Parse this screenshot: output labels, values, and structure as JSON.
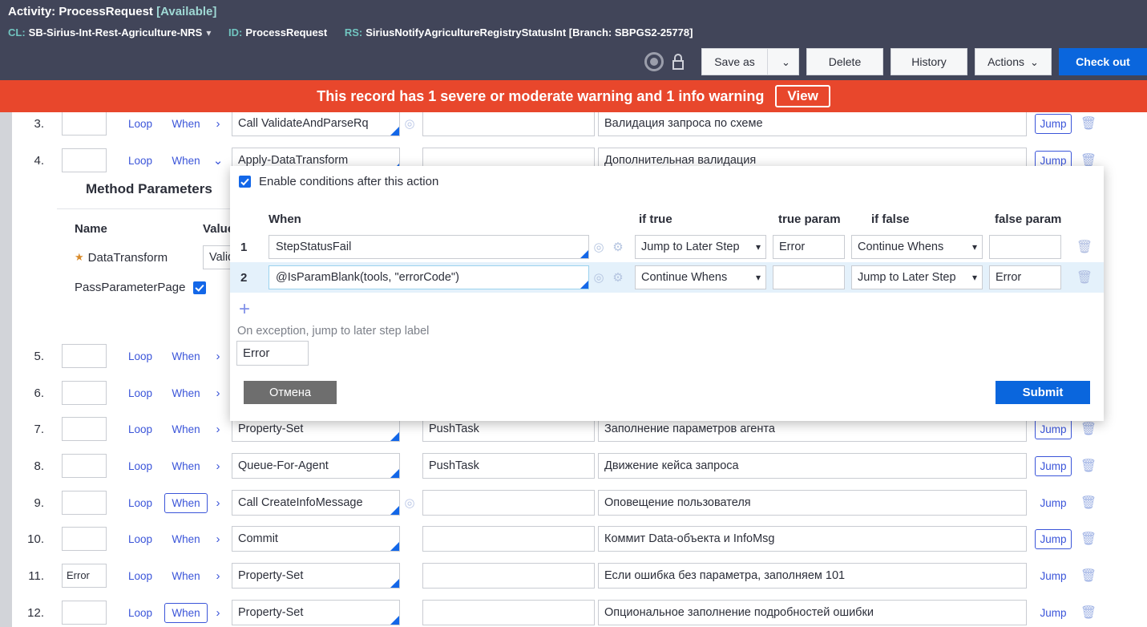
{
  "header": {
    "activity_label": "Activity:",
    "activity_name": "ProcessRequest",
    "activity_status": "[Available]",
    "cl_label": "CL:",
    "cl_value": "SB-Sirius-Int-Rest-Agriculture-NRS",
    "id_label": "ID:",
    "id_value": "ProcessRequest",
    "rs_label": "RS:",
    "rs_value": "SiriusNotifyAgricultureRegistryStatusInt [Branch: SBPGS2-25778]",
    "background_color": "#414559",
    "accent_color": "#71c5c0"
  },
  "toolbar": {
    "save_as_label": "Save as",
    "save_as_caret": "⌄",
    "delete_label": "Delete",
    "history_label": "History",
    "actions_label": "Actions",
    "actions_caret": "⌄",
    "check_out_label": "Check out",
    "primary_color": "#0a66dd"
  },
  "banner": {
    "message": "This record has 1 severe or moderate warning and 1 info warning",
    "view_label": "View",
    "color": "#e8472c"
  },
  "steps": [
    {
      "num": "3.",
      "label": "",
      "loop": "Loop",
      "when": "When",
      "when_boxed": false,
      "expander": "›",
      "method": "Call ValidateAndParseRq",
      "has_target_icon": true,
      "step_page": "",
      "description": "Валидация запроса по схеме",
      "jump": "Jump",
      "jump_boxed": true
    },
    {
      "num": "4.",
      "label": "",
      "loop": "Loop",
      "when": "When",
      "when_boxed": false,
      "expander": "⌄",
      "method": "Apply-DataTransform",
      "has_target_icon": false,
      "step_page": "",
      "description": "Дополнительная валидация",
      "jump": "Jump",
      "jump_boxed": true
    },
    {
      "num": "5.",
      "label": "",
      "loop": "Loop",
      "when": "When",
      "when_boxed": false,
      "expander": "›",
      "method": "",
      "has_target_icon": false,
      "step_page": "",
      "description": "",
      "jump": "",
      "jump_boxed": false
    },
    {
      "num": "6.",
      "label": "",
      "loop": "Loop",
      "when": "When",
      "when_boxed": false,
      "expander": "›",
      "method": "",
      "has_target_icon": false,
      "step_page": "",
      "description": "",
      "jump": "",
      "jump_boxed": false
    },
    {
      "num": "7.",
      "label": "",
      "loop": "Loop",
      "when": "When",
      "when_boxed": false,
      "expander": "›",
      "method": "Property-Set",
      "has_target_icon": false,
      "step_page": "PushTask",
      "description": "Заполнение параметров агента",
      "jump": "Jump",
      "jump_boxed": true
    },
    {
      "num": "8.",
      "label": "",
      "loop": "Loop",
      "when": "When",
      "when_boxed": false,
      "expander": "›",
      "method": "Queue-For-Agent",
      "has_target_icon": false,
      "step_page": "PushTask",
      "description": "Движение кейса запроса",
      "jump": "Jump",
      "jump_boxed": true
    },
    {
      "num": "9.",
      "label": "",
      "loop": "Loop",
      "when": "When",
      "when_boxed": true,
      "expander": "›",
      "method": "Call CreateInfoMessage",
      "has_target_icon": true,
      "step_page": "",
      "description": "Оповещение пользователя",
      "jump": "Jump",
      "jump_boxed": false
    },
    {
      "num": "10.",
      "label": "",
      "loop": "Loop",
      "when": "When",
      "when_boxed": false,
      "expander": "›",
      "method": "Commit",
      "has_target_icon": false,
      "step_page": "",
      "description": "Коммит Data-объекта и InfoMsg",
      "jump": "Jump",
      "jump_boxed": true
    },
    {
      "num": "11.",
      "label": "Error",
      "loop": "Loop",
      "when": "When",
      "when_boxed": false,
      "expander": "›",
      "method": "Property-Set",
      "has_target_icon": false,
      "step_page": "",
      "description": "Если ошибка без параметра, заполняем 101",
      "jump": "Jump",
      "jump_boxed": false
    },
    {
      "num": "12.",
      "label": "",
      "loop": "Loop",
      "when": "When",
      "when_boxed": true,
      "expander": "›",
      "method": "Property-Set",
      "has_target_icon": false,
      "step_page": "",
      "description": "Опциональное заполнение подробностей ошибки",
      "jump": "Jump",
      "jump_boxed": false
    }
  ],
  "method_parameters": {
    "title": "Method Parameters",
    "col_name": "Name",
    "col_value": "Value",
    "rows": [
      {
        "name": "DataTransform",
        "required": true,
        "value": "Valid"
      }
    ],
    "checkbox_row": {
      "name": "PassParameterPage",
      "checked": true
    }
  },
  "modal": {
    "enable_conditions_label": "Enable conditions after this action",
    "enable_conditions_checked": true,
    "columns": {
      "when": "When",
      "if_true": "if true",
      "true_param": "true param",
      "if_false": "if false",
      "false_param": "false param"
    },
    "rows": [
      {
        "index": "1",
        "when": "StepStatusFail",
        "if_true": "Jump to Later Step",
        "true_param": "Error",
        "if_false": "Continue Whens",
        "false_param": "",
        "selected": false
      },
      {
        "index": "2",
        "when": "@IsParamBlank(tools, \"errorCode\")",
        "if_true": "Continue Whens",
        "true_param": "",
        "if_false": "Jump to Later Step",
        "false_param": "Error",
        "selected": true
      }
    ],
    "add_row_label": "+",
    "exception_label": "On exception, jump to later step label",
    "exception_value": "Error",
    "cancel_label": "Отмена",
    "submit_label": "Submit",
    "submit_color": "#0a66dd",
    "cancel_color": "#6e6e6e"
  }
}
